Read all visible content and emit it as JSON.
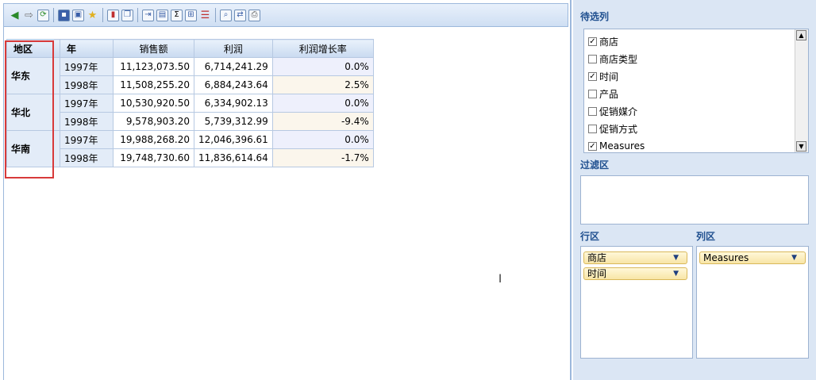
{
  "toolbar": {
    "buttons": [
      "back-icon",
      "forward-icon",
      "refresh-icon",
      "save-icon",
      "save-as-icon",
      "favorite-icon",
      "chart-icon",
      "copy-icon",
      "export-icon",
      "filter-icon",
      "sum-icon",
      "calc-field-icon",
      "sort-icon",
      "search-icon",
      "swap-icon",
      "print-icon"
    ]
  },
  "table": {
    "headers": [
      "地区",
      "年",
      "销售额",
      "利润",
      "利润增长率"
    ],
    "regions": [
      "华东",
      "华北",
      "华南"
    ],
    "rows": [
      {
        "year": "1997年",
        "sales": "11,123,073.50",
        "profit": "6,714,241.29",
        "rate": "0.0%"
      },
      {
        "year": "1998年",
        "sales": "11,508,255.20",
        "profit": "6,884,243.64",
        "rate": "2.5%"
      },
      {
        "year": "1997年",
        "sales": "10,530,920.50",
        "profit": "6,334,902.13",
        "rate": "0.0%"
      },
      {
        "year": "1998年",
        "sales": "9,578,903.20",
        "profit": "5,739,312.99",
        "rate": "-9.4%"
      },
      {
        "year": "1997年",
        "sales": "19,988,268.20",
        "profit": "12,046,396.61",
        "rate": "0.0%"
      },
      {
        "year": "1998年",
        "sales": "19,748,730.60",
        "profit": "11,836,614.64",
        "rate": "-1.7%"
      }
    ]
  },
  "panel": {
    "candidates_title": "待选列",
    "fields": [
      {
        "label": "商店",
        "checked": true
      },
      {
        "label": "商店类型",
        "checked": false
      },
      {
        "label": "时间",
        "checked": true
      },
      {
        "label": "产品",
        "checked": false
      },
      {
        "label": "促销媒介",
        "checked": false
      },
      {
        "label": "促销方式",
        "checked": false
      },
      {
        "label": "Measures",
        "checked": true
      }
    ],
    "filter_title": "过滤区",
    "rows_title": "行区",
    "cols_title": "列区",
    "row_items": [
      "商店",
      "时间"
    ],
    "col_items": [
      "Measures"
    ]
  },
  "colors": {
    "accent": "#1f4f8f",
    "highlight_border": "#d83a3a",
    "pill": "#f8e5a6"
  }
}
